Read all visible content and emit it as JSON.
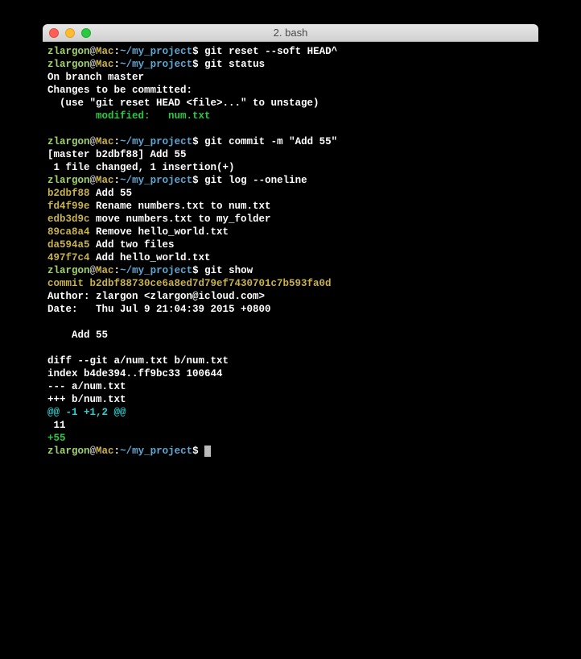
{
  "titlebar": {
    "title": "2. bash"
  },
  "prompt": {
    "user": "zlargon",
    "at": "@",
    "host": "Mac",
    "colon": ":",
    "path": "~/my_project",
    "dollar": "$ "
  },
  "cmd1": "git reset --soft HEAD^",
  "cmd2": "git status",
  "status": {
    "l1": "On branch master",
    "l2": "Changes to be committed:",
    "l3": "  (use \"git reset HEAD <file>...\" to unstage)",
    "blank": "",
    "l4a": "        modified:   ",
    "l4b": "num.txt"
  },
  "cmd3": "git commit -m \"Add 55\"",
  "commit_out": {
    "l1": "[master b2dbf88] Add 55",
    "l2": " 1 file changed, 1 insertion(+)"
  },
  "cmd4": "git log --oneline",
  "log": [
    {
      "hash": "b2dbf88",
      "msg": " Add 55"
    },
    {
      "hash": "fd4f99e",
      "msg": " Rename numbers.txt to num.txt"
    },
    {
      "hash": "edb3d9c",
      "msg": " move numbers.txt to my_folder"
    },
    {
      "hash": "89ca8a4",
      "msg": " Remove hello_world.txt"
    },
    {
      "hash": "da594a5",
      "msg": " Add two files"
    },
    {
      "hash": "497f7c4",
      "msg": " Add hello_world.txt"
    }
  ],
  "cmd5": "git show",
  "show": {
    "commit": "commit b2dbf88730ce6a8ed7d79ef7430701c7b593fa0d",
    "author": "Author: zlargon <zlargon@icloud.com>",
    "date": "Date:   Thu Jul 9 21:04:39 2015 +0800",
    "subject": "    Add 55",
    "diff1": "diff --git a/num.txt b/num.txt",
    "diff2": "index b4de394..ff9bc33 100644",
    "diff3": "--- a/num.txt",
    "diff4": "+++ b/num.txt",
    "hunk": "@@ -1 +1,2 @@",
    "ctx": " 11",
    "add": "+55"
  }
}
